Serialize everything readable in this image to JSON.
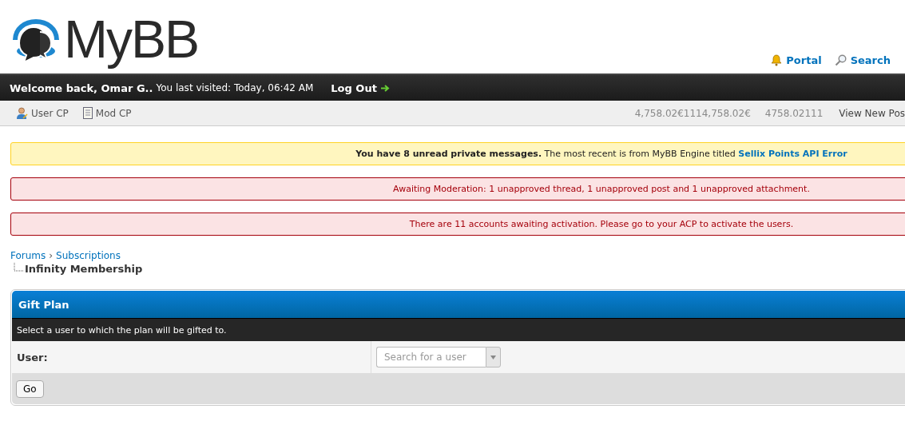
{
  "header": {
    "logo": "MyBB",
    "links": [
      {
        "kind": "bell",
        "label": "Portal"
      },
      {
        "kind": "search",
        "label": "Search"
      }
    ]
  },
  "welcome_bar": {
    "greeting": "Welcome back, Omar G..",
    "last_visit": "You last visited: Today, 06:42 AM",
    "logout": "Log Out"
  },
  "user_bar": {
    "links": [
      {
        "kind": "user",
        "label": "User CP"
      },
      {
        "kind": "notepad",
        "label": "Mod CP"
      }
    ],
    "stats": [
      "4,758.02€1114,758.02€",
      "4758.02111"
    ],
    "view_new": "View New Pos"
  },
  "alerts": [
    {
      "kind": "info",
      "text": "**You have 8 unread private messages.** The most recent is from MyBB Engine titled ",
      "link": "Sellix Points API Error"
    },
    {
      "kind": "error",
      "text": "Awaiting Moderation: 1 unapproved thread, 1 unapproved post and 1 unapproved attachment."
    },
    {
      "kind": "error",
      "text": "There are 11 accounts awaiting activation. Please go to your ACP to activate the users."
    }
  ],
  "breadcrumb": {
    "links": [
      "Forums",
      "Subscriptions"
    ],
    "separator": "›",
    "current": "Infinity Membership"
  },
  "panel": {
    "title": "Gift Plan",
    "description": "Select a user to which the plan will be gifted to.",
    "field_label": "User:",
    "placeholder": "Search for a user",
    "button": "Go"
  }
}
